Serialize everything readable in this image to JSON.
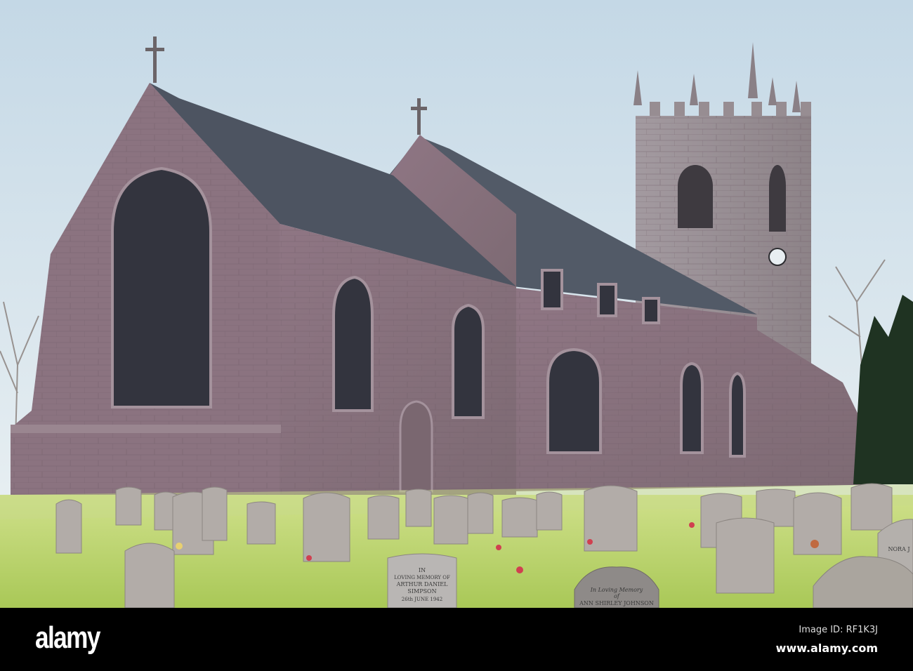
{
  "photo": {
    "subject": "stone church with tower and graveyard",
    "colors": {
      "sky_top": "#c4d8e6",
      "sky_bottom": "#eef3f4",
      "stone": "#8a7480",
      "roof": "#4f5663",
      "grass": "#b9d46a",
      "yew": "#1f3322"
    },
    "gravestones": {
      "simpson": {
        "line1": "IN",
        "line2": "LOVING MEMORY OF",
        "line3": "ARTHUR DANIEL",
        "line4": "SIMPSON",
        "line5": "26th JUNE 1942"
      },
      "johnson": {
        "line1": "In Loving Memory",
        "line2": "of",
        "line3": "ANN SHIRLEY JOHNSON"
      },
      "nora": {
        "line1": "NORA J"
      }
    }
  },
  "footer": {
    "logo": "alamy",
    "image_id": "Image ID: RF1K3J",
    "website": "www.alamy.com"
  }
}
